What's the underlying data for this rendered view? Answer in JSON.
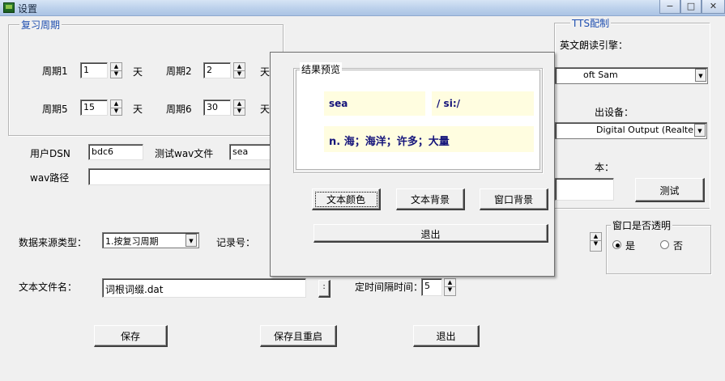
{
  "window": {
    "title": "设置",
    "minimize": "−",
    "maximize": "□",
    "close": "✕"
  },
  "review_period": {
    "legend": "复习周期",
    "unit": "天",
    "periods": [
      {
        "label": "周期1",
        "value": "1"
      },
      {
        "label": "周期2",
        "value": "2"
      },
      {
        "label": "周期5",
        "value": "15"
      },
      {
        "label": "周期6",
        "value": "30"
      }
    ],
    "unit_partial": "天"
  },
  "dsn": {
    "label": "用户DSN",
    "value": "bdc6"
  },
  "test_wav": {
    "label": "测试wav文件",
    "value": "sea"
  },
  "wav_path": {
    "label": "wav路径",
    "value": ""
  },
  "data_source": {
    "label": "数据来源类型：",
    "value": "1.按复习周期"
  },
  "record_no": {
    "label": "记录号："
  },
  "text_file": {
    "label": "文本文件名：",
    "value": "词根词缀.dat",
    "browse": ":"
  },
  "timer": {
    "label": "定时间隔时间：",
    "value": "5"
  },
  "buttons": {
    "save": "保存",
    "save_restart": "保存且重启",
    "exit": "退出"
  },
  "tts": {
    "legend": "TTS配制",
    "engine_label": "英文朗读引擎：",
    "engine_value": "oft Sam",
    "output_label": "出设备：",
    "output_value": "Digital Output (Realtek",
    "text_label": "本：",
    "test_button": "测试"
  },
  "transparent": {
    "legend": "窗口是否透明",
    "yes": "是",
    "no": "否",
    "selected": "yes"
  },
  "preview_dialog": {
    "legend": "结果预览",
    "word": "sea",
    "phonetic": "/ si:/",
    "meaning": "n. 海；海洋；许多；大量",
    "text_color": "文本颜色",
    "text_bg": "文本背景",
    "window_bg": "窗口背景",
    "exit": "退出"
  },
  "colors": {
    "legend_blue": "#1f4fb0",
    "preview_text": "#14137a",
    "preview_cell": "#fffde0"
  },
  "icons": {
    "spin_up": "▲",
    "spin_down": "▼",
    "combo": "▼"
  }
}
